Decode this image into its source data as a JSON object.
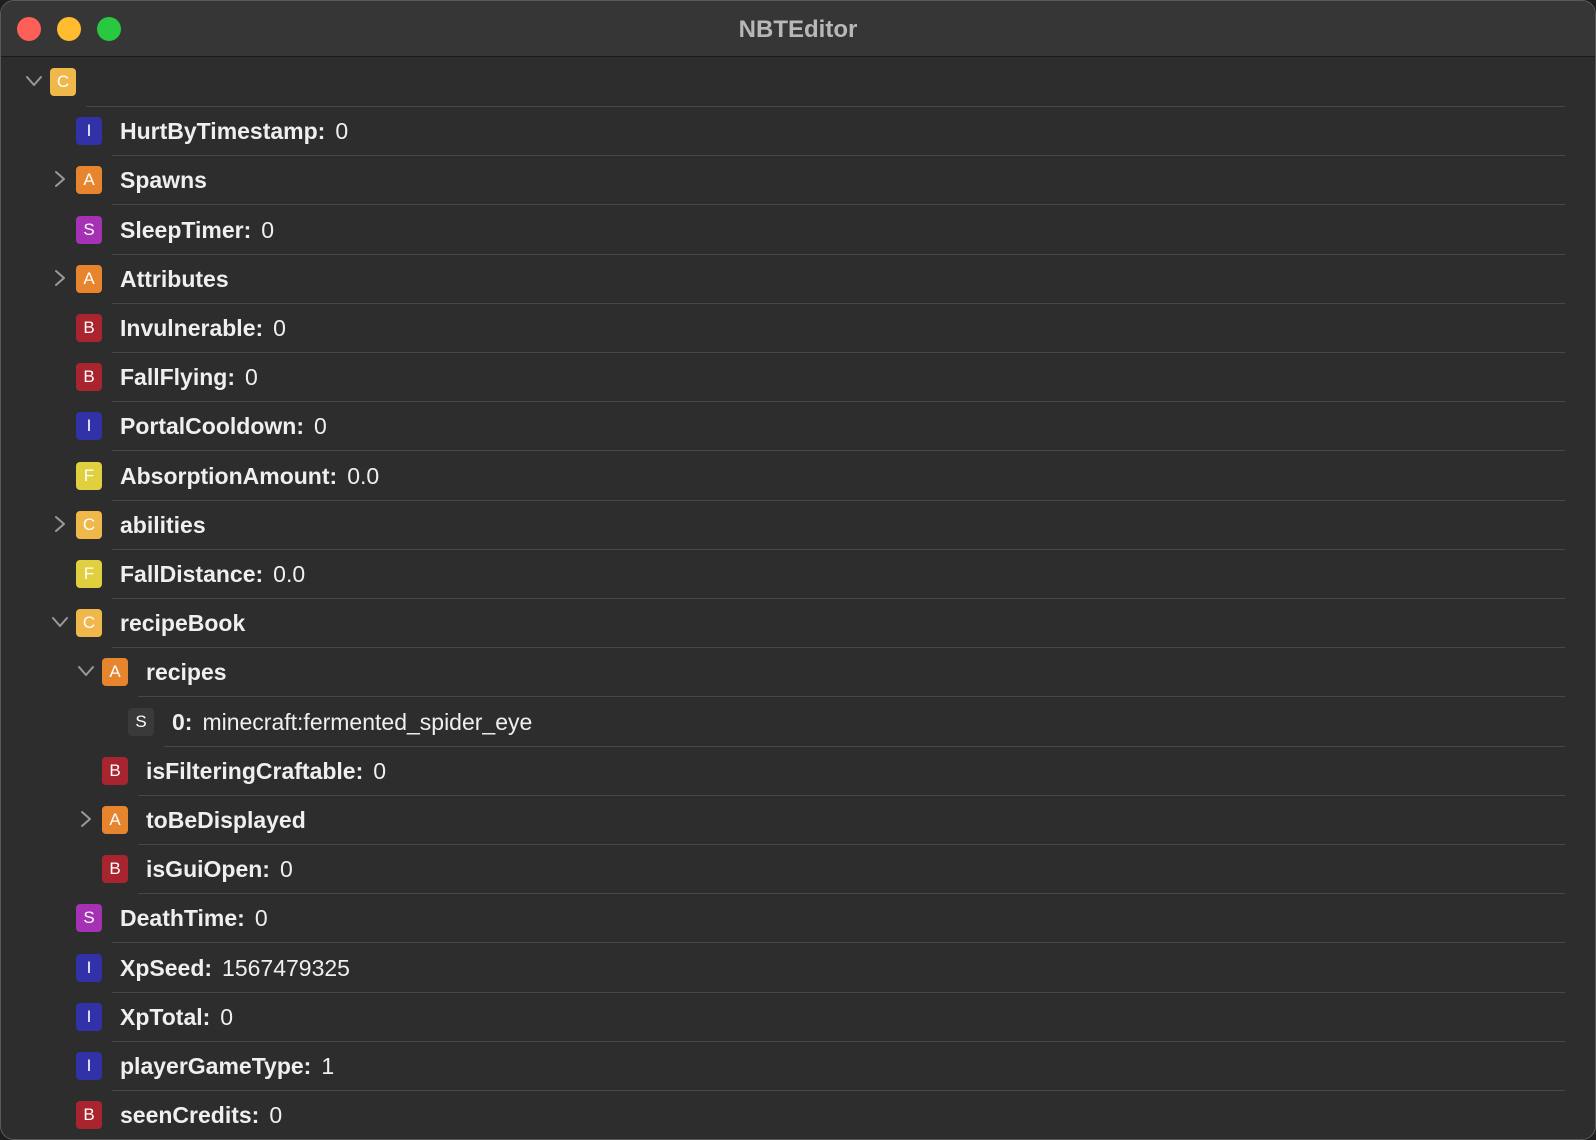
{
  "window": {
    "title": "NBTEditor"
  },
  "tree": {
    "rows": [
      {
        "depth": 0,
        "type": "C",
        "key": "",
        "colon": "",
        "value": "",
        "chevron": "open"
      },
      {
        "depth": 1,
        "type": "I",
        "key": "HurtByTimestamp",
        "colon": ":",
        "value": "0",
        "chevron": ""
      },
      {
        "depth": 1,
        "type": "A",
        "key": "Spawns",
        "colon": "",
        "value": "",
        "chevron": "closed"
      },
      {
        "depth": 1,
        "type": "S",
        "key": "SleepTimer",
        "colon": ":",
        "value": "0",
        "chevron": ""
      },
      {
        "depth": 1,
        "type": "A",
        "key": "Attributes",
        "colon": "",
        "value": "",
        "chevron": "closed"
      },
      {
        "depth": 1,
        "type": "B",
        "key": "Invulnerable",
        "colon": ":",
        "value": "0",
        "chevron": ""
      },
      {
        "depth": 1,
        "type": "B",
        "key": "FallFlying",
        "colon": ":",
        "value": "0",
        "chevron": ""
      },
      {
        "depth": 1,
        "type": "I",
        "key": "PortalCooldown",
        "colon": ":",
        "value": "0",
        "chevron": ""
      },
      {
        "depth": 1,
        "type": "F",
        "key": "AbsorptionAmount",
        "colon": ":",
        "value": "0.0",
        "chevron": ""
      },
      {
        "depth": 1,
        "type": "C",
        "key": "abilities",
        "colon": "",
        "value": "",
        "chevron": "closed"
      },
      {
        "depth": 1,
        "type": "F",
        "key": "FallDistance",
        "colon": ":",
        "value": "0.0",
        "chevron": ""
      },
      {
        "depth": 1,
        "type": "C",
        "key": "recipeBook",
        "colon": "",
        "value": "",
        "chevron": "open"
      },
      {
        "depth": 2,
        "type": "A",
        "key": "recipes",
        "colon": "",
        "value": "",
        "chevron": "open"
      },
      {
        "depth": 3,
        "type": "S",
        "key": "0",
        "colon": ":",
        "value": "minecraft:fermented_spider_eye",
        "chevron": "",
        "string_item": true
      },
      {
        "depth": 2,
        "type": "B",
        "key": "isFilteringCraftable",
        "colon": ":",
        "value": "0",
        "chevron": ""
      },
      {
        "depth": 2,
        "type": "A",
        "key": "toBeDisplayed",
        "colon": "",
        "value": "",
        "chevron": "closed"
      },
      {
        "depth": 2,
        "type": "B",
        "key": "isGuiOpen",
        "colon": ":",
        "value": "0",
        "chevron": ""
      },
      {
        "depth": 1,
        "type": "S",
        "key": "DeathTime",
        "colon": ":",
        "value": "0",
        "chevron": ""
      },
      {
        "depth": 1,
        "type": "I",
        "key": "XpSeed",
        "colon": ":",
        "value": "1567479325",
        "chevron": ""
      },
      {
        "depth": 1,
        "type": "I",
        "key": "XpTotal",
        "colon": ":",
        "value": "0",
        "chevron": ""
      },
      {
        "depth": 1,
        "type": "I",
        "key": "playerGameType",
        "colon": ":",
        "value": "1",
        "chevron": ""
      },
      {
        "depth": 1,
        "type": "B",
        "key": "seenCredits",
        "colon": ":",
        "value": "0",
        "chevron": ""
      }
    ]
  },
  "type_colors": {
    "C": "#f0b84a",
    "I": "#3131a8",
    "A": "#e7852f",
    "S": "#a532b5",
    "B": "#a8252f",
    "F": "#e0d040",
    "string_item": "#3a3a3a"
  }
}
